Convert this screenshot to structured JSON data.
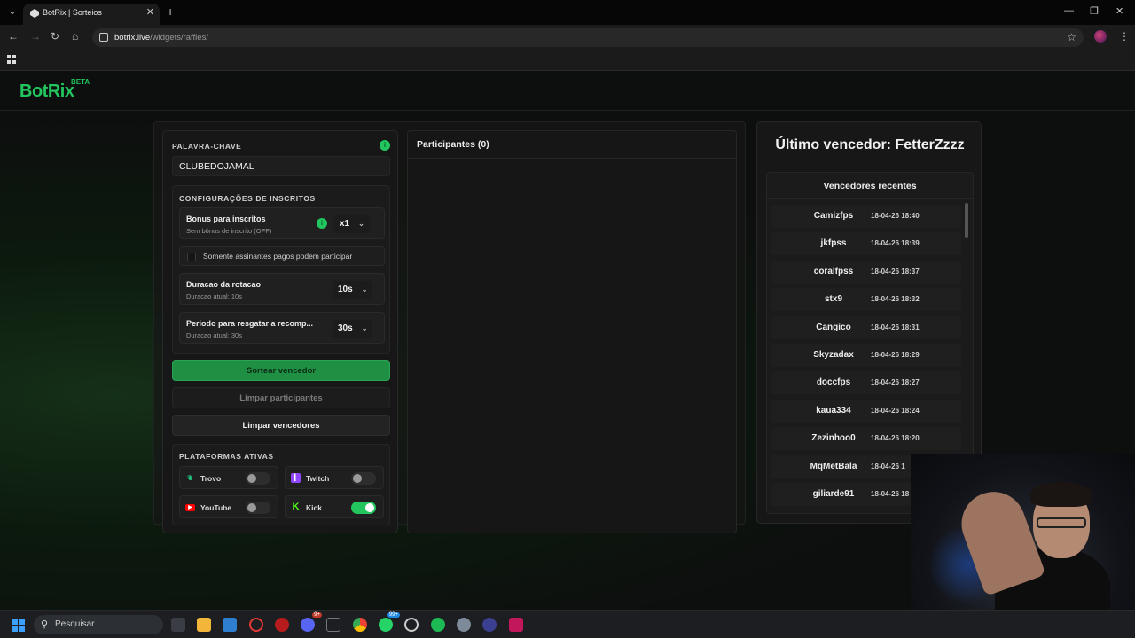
{
  "browser": {
    "tab_title": "BotRix | Sorteios",
    "url_host": "botrix.live",
    "url_path": "/widgets/raffles/"
  },
  "header": {
    "logo": "BotRix",
    "beta": "BETA"
  },
  "keyword": {
    "label": "PALAVRA-CHAVE",
    "value": "CLUBEDOJAMAL",
    "info_icon": "info-icon"
  },
  "subs_config": {
    "title": "CONFIGURAÇÕES DE INSCRITOS",
    "bonus": {
      "title": "Bonus para inscritos",
      "sub": "Sem bônus de inscrito (OFF)",
      "value": "x1"
    },
    "paid_only": "Somente assinantes pagos podem participar",
    "rotation": {
      "title": "Duracao da rotacao",
      "sub": "Duracao atual: 10s",
      "value": "10s"
    },
    "claim": {
      "title": "Periodo para resgatar a recomp...",
      "sub": "Duracao atual: 30s",
      "value": "30s"
    }
  },
  "buttons": {
    "draw": "Sortear vencedor",
    "clear_participants": "Limpar participantes",
    "clear_winners": "Limpar vencedores"
  },
  "platforms": {
    "title": "PLATAFORMAS ATIVAS",
    "items": [
      {
        "name": "Trovo",
        "on": false,
        "color": "#1fd18a"
      },
      {
        "name": "Twitch",
        "on": false,
        "color": "#9146ff"
      },
      {
        "name": "YouTube",
        "on": false,
        "color": "#ff0000"
      },
      {
        "name": "Kick",
        "on": true,
        "color": "#53fc18"
      }
    ]
  },
  "participants": {
    "title": "Participantes (0)"
  },
  "winners": {
    "last": "Último vencedor: FetterZzzz",
    "recent_title": "Vencedores recentes",
    "list": [
      {
        "name": "Camizfps",
        "time": "18-04-26 18:40"
      },
      {
        "name": "jkfpss",
        "time": "18-04-26 18:39"
      },
      {
        "name": "coralfpss",
        "time": "18-04-26 18:37"
      },
      {
        "name": "stx9",
        "time": "18-04-26 18:32"
      },
      {
        "name": "Cangico",
        "time": "18-04-26 18:31"
      },
      {
        "name": "Skyzadax",
        "time": "18-04-26 18:29"
      },
      {
        "name": "doccfps",
        "time": "18-04-26 18:27"
      },
      {
        "name": "kaua334",
        "time": "18-04-26 18:24"
      },
      {
        "name": "Zezinhoo0",
        "time": "18-04-26 18:20"
      },
      {
        "name": "MqMetBala",
        "time": "18-04-26 1"
      },
      {
        "name": "giliarde91",
        "time": "18-04-26 18"
      }
    ]
  },
  "taskbar": {
    "search": "Pesquisar"
  },
  "colors": {
    "accent": "#22c55e"
  }
}
